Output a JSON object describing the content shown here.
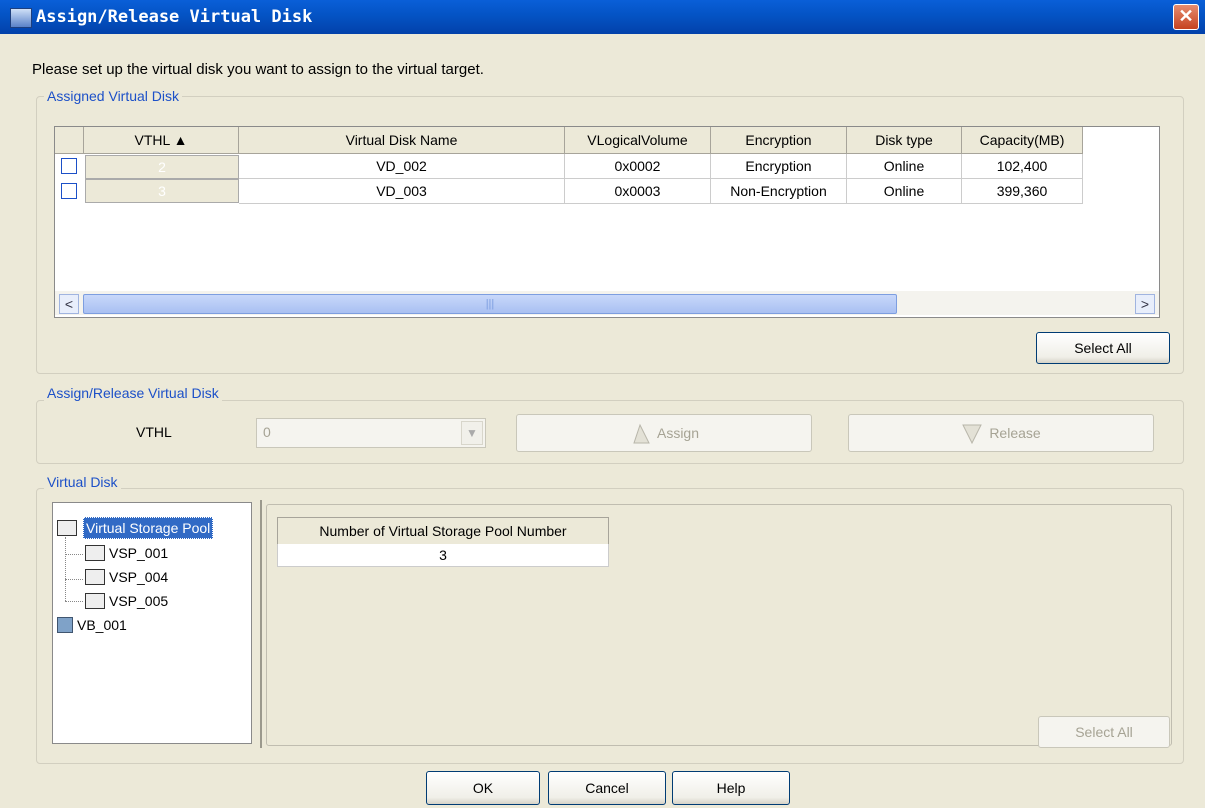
{
  "window": {
    "title": "Assign/Release Virtual Disk",
    "close_label": "✕"
  },
  "intro": "Please set up the virtual disk you want to assign to the virtual target.",
  "assigned": {
    "legend": "Assigned Virtual Disk",
    "columns": [
      "VTHL ▲",
      "Virtual Disk Name",
      "VLogicalVolume",
      "Encryption",
      "Disk type",
      "Capacity(MB)"
    ],
    "rows": [
      {
        "vthl": "2",
        "name": "VD_002",
        "vlv": "0x0002",
        "enc": "Encryption",
        "type": "Online",
        "cap": "102,400"
      },
      {
        "vthl": "3",
        "name": "VD_003",
        "vlv": "0x0003",
        "enc": "Non-Encryption",
        "type": "Online",
        "cap": "399,360"
      }
    ],
    "scroll_left": "<",
    "scroll_right": ">",
    "scroll_grip": "|||",
    "select_all": "Select All"
  },
  "assign_release": {
    "legend": "Assign/Release Virtual Disk",
    "vthl_label": "VTHL",
    "vthl_value": "0",
    "assign_label": "Assign",
    "release_label": "Release"
  },
  "virtual_disk": {
    "legend": "Virtual Disk",
    "tree": {
      "root": "Virtual Storage Pool",
      "children": [
        "VSP_001",
        "VSP_004",
        "VSP_005"
      ],
      "other": "VB_001"
    },
    "info_header": "Number of Virtual Storage Pool Number",
    "info_value": "3",
    "select_all": "Select All"
  },
  "footer": {
    "ok": "OK",
    "cancel": "Cancel",
    "help": "Help"
  }
}
